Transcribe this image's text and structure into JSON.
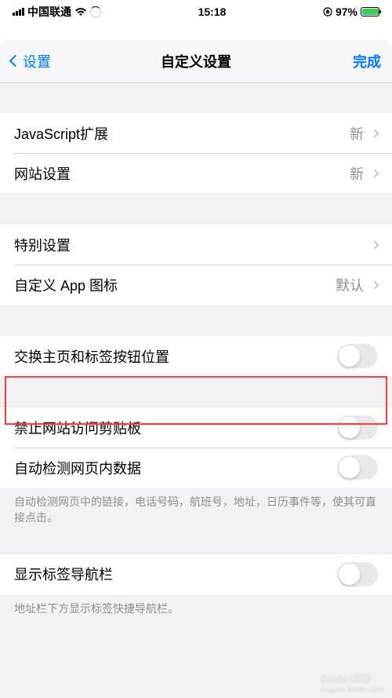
{
  "status": {
    "carrier": "中国联通",
    "time": "15:18",
    "battery_pct": "97%"
  },
  "nav": {
    "back_label": "设置",
    "title": "自定义设置",
    "done_label": "完成"
  },
  "group1": [
    {
      "label": "JavaScript扩展",
      "value": "新"
    },
    {
      "label": "网站设置",
      "value": "新"
    }
  ],
  "group2": [
    {
      "label": "特别设置",
      "value": ""
    },
    {
      "label": "自定义 App 图标",
      "value": "默认"
    }
  ],
  "group3": {
    "switch_label": "交换主页和标签按钮位置"
  },
  "group4": {
    "clipboard_label": "禁止网站访问剪贴板",
    "autodetect_label": "自动检测网页内数据",
    "autodetect_footer": "自动检测网页中的链接，电话号码，航班号，地址，日历事件等，使其可直接点击。"
  },
  "group5": {
    "tab_nav_label": "显示标签导航栏",
    "tab_nav_footer": "地址栏下方显示标签快捷导航栏。"
  },
  "watermark": {
    "brand": "Baidu 经验",
    "sub": "jingyan.baidu.com"
  }
}
